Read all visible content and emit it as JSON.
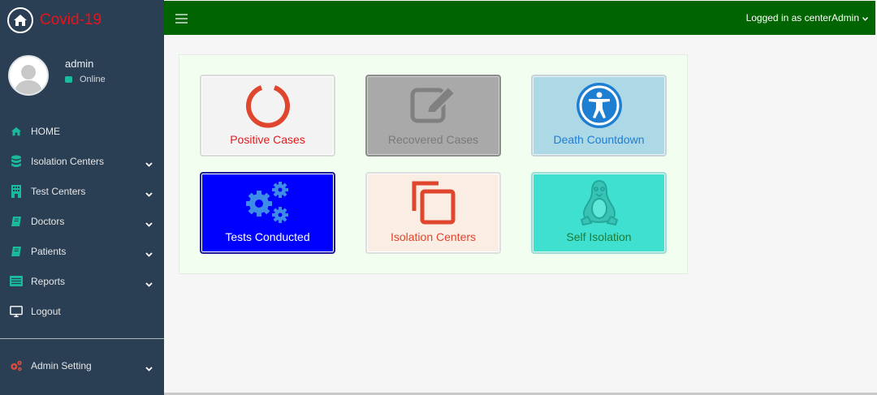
{
  "brand": {
    "title": "Covid-19",
    "icon": "home-icon"
  },
  "user": {
    "name": "admin",
    "status": "Online"
  },
  "menu": [
    {
      "label": "HOME",
      "icon": "home-icon",
      "has_submenu": false
    },
    {
      "label": "Isolation Centers",
      "icon": "database-icon",
      "has_submenu": true
    },
    {
      "label": "Test Centers",
      "icon": "building-icon",
      "has_submenu": true
    },
    {
      "label": "Doctors",
      "icon": "book-icon",
      "has_submenu": true
    },
    {
      "label": "Patients",
      "icon": "book-icon",
      "has_submenu": true
    },
    {
      "label": "Reports",
      "icon": "list-icon",
      "has_submenu": true
    },
    {
      "label": "Logout",
      "icon": "monitor-icon",
      "has_submenu": false
    }
  ],
  "admin_setting": {
    "label": "Admin Setting",
    "icon": "cogs-icon"
  },
  "topbar": {
    "logged_in_text": "Logged in as centerAdmin"
  },
  "tiles": [
    {
      "label": "Positive Cases",
      "icon": "power-circle-icon",
      "bg": "#f3f3f3",
      "text_color": "#e31b1b"
    },
    {
      "label": "Recovered Cases",
      "icon": "edit-icon",
      "bg": "#a9a9a9",
      "text_color": "#7a7a7a"
    },
    {
      "label": "Death Countdown",
      "icon": "accessibility-icon",
      "bg": "#add8e6",
      "text_color": "#1e7ed1"
    },
    {
      "label": "Tests Conducted",
      "icon": "gears-icon",
      "bg": "#0000ff",
      "text_color": "#ffffff"
    },
    {
      "label": "Isolation Centers",
      "icon": "copy-icon",
      "bg": "#faede4",
      "text_color": "#e0452e"
    },
    {
      "label": "Self Isolation",
      "icon": "linux-icon",
      "bg": "#40e0d0",
      "text_color": "#1e7a34"
    }
  ],
  "colors": {
    "sidebar": "#2a3f54",
    "topbar": "#006400",
    "brand_title": "#e8141b",
    "accent": "#1abb9c"
  }
}
